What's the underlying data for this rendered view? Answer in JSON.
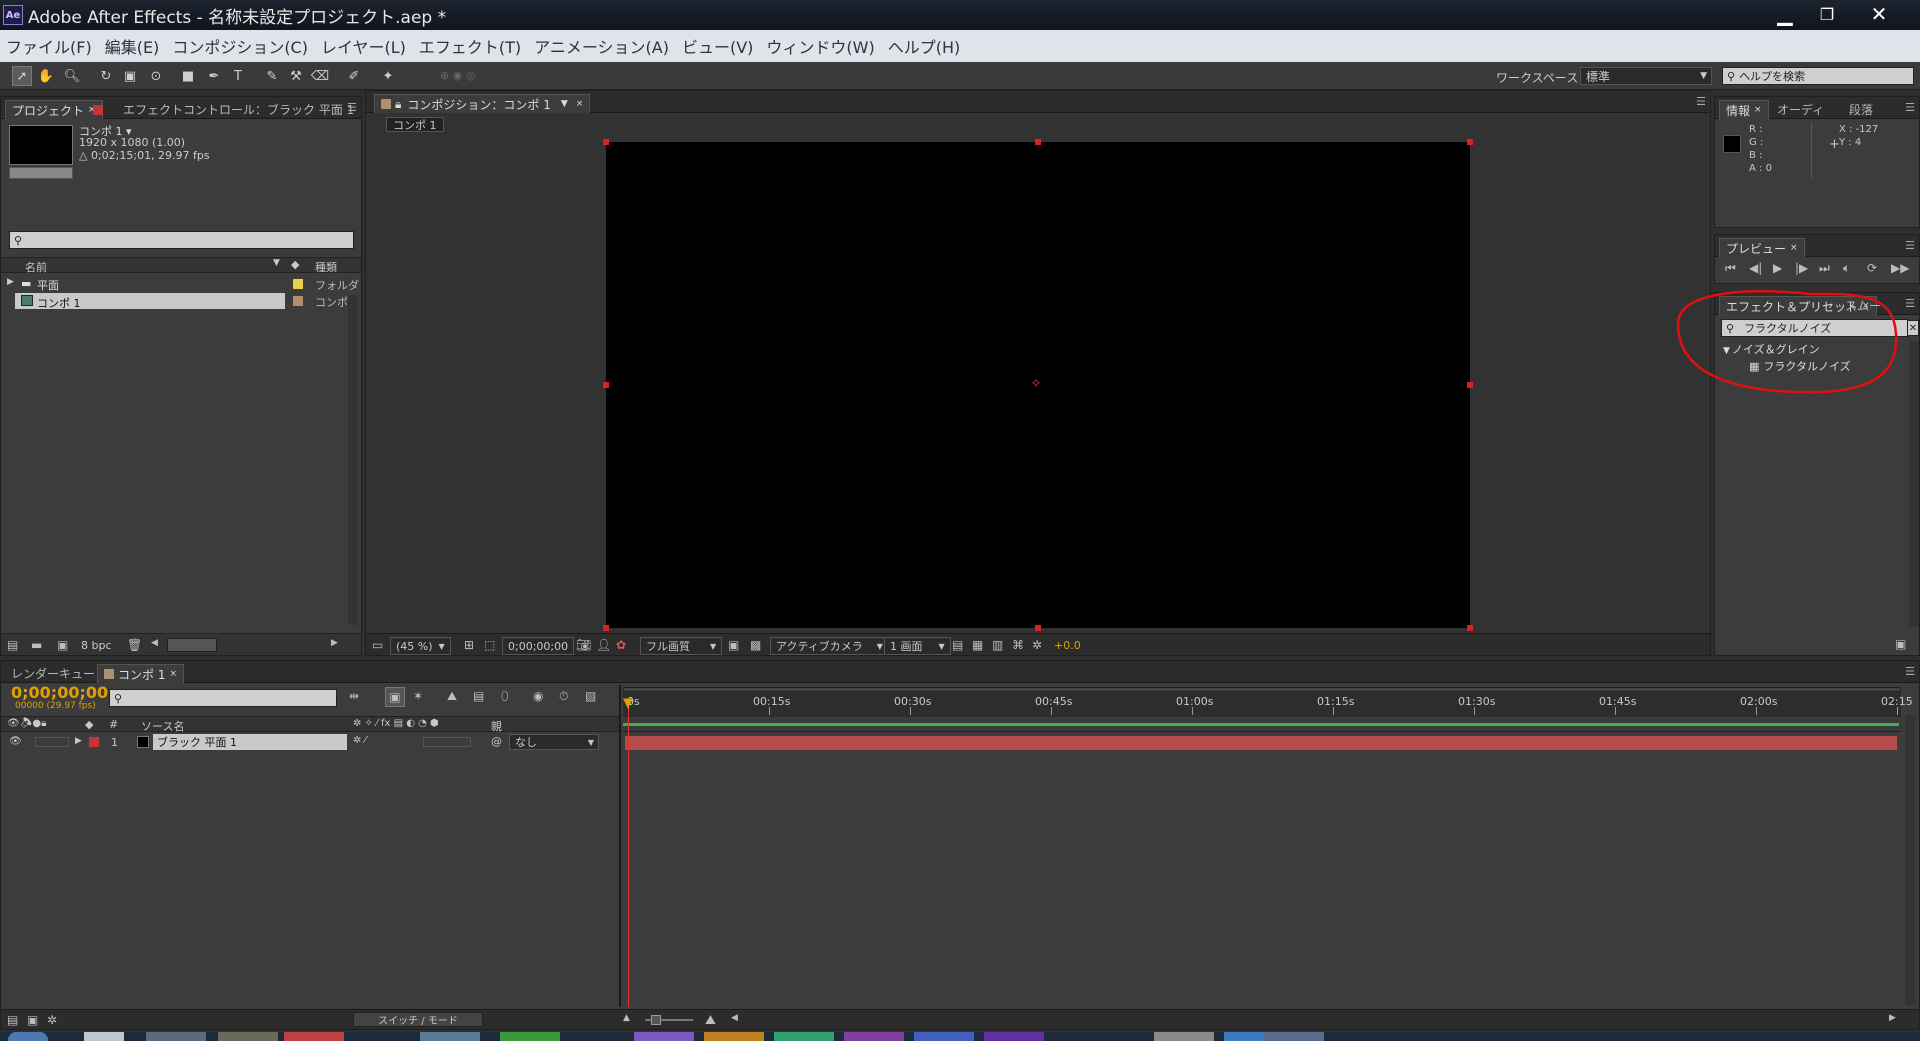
{
  "window": {
    "title": "Adobe After Effects - 名称未設定プロジェクト.aep *",
    "app_badge": "Ae",
    "minimize": "▁",
    "maximize": "❐",
    "close": "✕"
  },
  "menu": [
    "ファイル(F)",
    "編集(E)",
    "コンポジション(C)",
    "レイヤー(L)",
    "エフェクト(T)",
    "アニメーション(A)",
    "ビュー(V)",
    "ウィンドウ(W)",
    "ヘルプ(H)"
  ],
  "toolbar": {
    "workspace_label": "ワークスペース：",
    "workspace_value": "標準",
    "help_search_placeholder": "ヘルプを検索"
  },
  "project_panel": {
    "tab_project": "プロジェクト",
    "tab_effect_controls": "エフェクトコントロール：ブラック 平面 1",
    "comp_name": "コンポ 1 ▾",
    "comp_size": "1920 x 1080 (1.00)",
    "comp_duration": "△ 0;02;15;01, 29.97 fps",
    "col_name": "名前",
    "col_type": "種類",
    "items": [
      {
        "name": "平面",
        "type": "フォルダ",
        "label_color": "#e8d24a"
      },
      {
        "name": "コンポ 1",
        "type": "コンポ",
        "label_color": "#b09070"
      }
    ],
    "bpc": "8 bpc"
  },
  "comp_panel": {
    "tab": "コンポジション：コンポ 1",
    "breadcrumb": "コンポ 1",
    "zoom": "(45 %)",
    "timecode": "0;00;00;00",
    "resolution": "フル画質",
    "camera": "アクティブカメラ",
    "views": "1 画面",
    "exposure": "+0.0"
  },
  "info_panel": {
    "tab_info": "情報",
    "tab_audio": "オーディ",
    "tab_paragraph": "段落",
    "r": "R :",
    "g": "G :",
    "b": "B :",
    "a": "A : 0",
    "x": "X : -127",
    "y": "Y : 4"
  },
  "preview_panel": {
    "tab": "プレビュー"
  },
  "effects_panel": {
    "tab": "エフェクト＆プリセット",
    "tab_smoother": "スムー",
    "search_value": "フラクタルノイズ",
    "category": "ノイズ＆グレイン",
    "effect": "フラクタルノイズ"
  },
  "timeline": {
    "tab_render": "レンダーキュー",
    "tab_comp": "コンポ 1",
    "timecode": "0;00;00;00",
    "frame_info": "00000 (29.97 fps)",
    "col_num": "#",
    "col_source": "ソース名",
    "col_parent": "親",
    "layer_num": "1",
    "layer_name": "ブラック 平面 1",
    "layer_parent": "なし",
    "switch_mode": "スイッチ / モード",
    "ruler": [
      "0s",
      "00:15s",
      "00:30s",
      "00:45s",
      "01:00s",
      "01:15s",
      "01:30s",
      "01:45s",
      "02:00s",
      "02:15"
    ]
  },
  "colors": {
    "layer_label": "#c83434",
    "layer_bar": "#b54b4b",
    "timecode": "#e0a000",
    "annotation": "#e01010"
  }
}
